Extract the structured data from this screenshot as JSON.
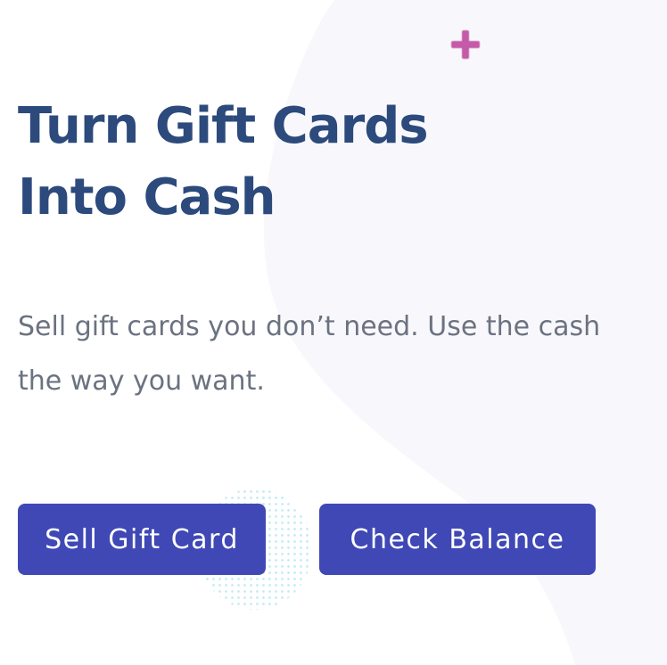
{
  "hero": {
    "title_line1": "Turn Gift Cards",
    "title_line2": "Into Cash",
    "subtitle": "Sell gift cards you don’t need. Use the cash the way you want."
  },
  "buttons": {
    "sell_label": "Sell Gift Card",
    "balance_label": "Check Balance"
  },
  "colors": {
    "title": "#2c4a7c",
    "subtitle": "#6b7280",
    "button_bg": "#3f48b5",
    "button_text": "#ffffff",
    "plus_accent": "#c45aa8",
    "dots": "#bfeaf0",
    "background_blob": "#f8f8fc"
  },
  "icons": {
    "decoration_plus": "plus-icon",
    "decoration_dots": "dot-pattern"
  }
}
